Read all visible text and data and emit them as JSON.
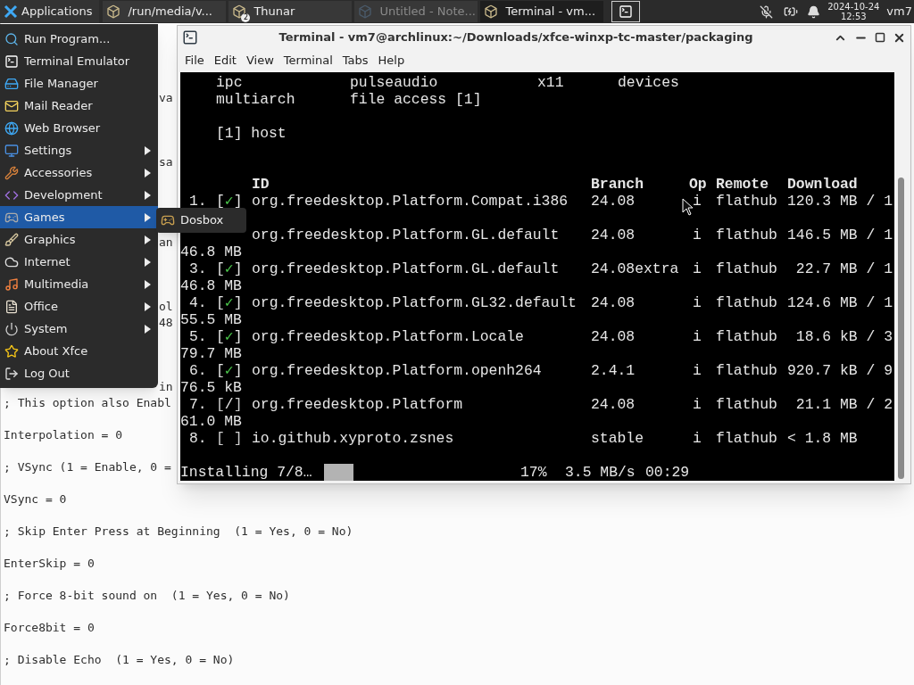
{
  "taskbar": {
    "applications": "Applications",
    "tasks": [
      {
        "title": "/run/media/v...",
        "selected": false,
        "minimized": false
      },
      {
        "title": "Thunar",
        "selected": false,
        "minimized": false,
        "badge": "2"
      },
      {
        "title": "Untitled - Note...",
        "selected": false,
        "minimized": true
      },
      {
        "title": "Terminal - vm...",
        "selected": true,
        "minimized": false
      }
    ],
    "date": "2024-10-24",
    "time": "12:53",
    "user": "vm7"
  },
  "editor": {
    "covered_lines": [
      "va",
      "sa",
      "an",
      "ol",
      "48",
      "in"
    ],
    "lines": [
      "; This option also Enabl",
      "Interpolation = 0",
      "; VSync (1 = Enable, 0 =",
      "VSync = 0",
      "; Skip Enter Press at Beginning  (1 = Yes, 0 = No)",
      "EnterSkip = 0",
      "; Force 8-bit sound on  (1 = Yes, 0 = No)",
      "Force8bit = 0",
      "; Disable Echo  (1 = Yes, 0 = No)"
    ]
  },
  "app_menu": {
    "items": [
      {
        "label": "Run Program...",
        "has_submenu": false,
        "selected": false
      },
      {
        "label": "Terminal Emulator",
        "has_submenu": false,
        "selected": false
      },
      {
        "label": "File Manager",
        "has_submenu": false,
        "selected": false
      },
      {
        "label": "Mail Reader",
        "has_submenu": false,
        "selected": false
      },
      {
        "label": "Web Browser",
        "has_submenu": false,
        "selected": false
      },
      {
        "label": "Settings",
        "has_submenu": true,
        "selected": false
      },
      {
        "label": "Accessories",
        "has_submenu": true,
        "selected": false
      },
      {
        "label": "Development",
        "has_submenu": true,
        "selected": false
      },
      {
        "label": "Games",
        "has_submenu": true,
        "selected": true
      },
      {
        "label": "Graphics",
        "has_submenu": true,
        "selected": false
      },
      {
        "label": "Internet",
        "has_submenu": true,
        "selected": false
      },
      {
        "label": "Multimedia",
        "has_submenu": true,
        "selected": false
      },
      {
        "label": "Office",
        "has_submenu": true,
        "selected": false
      },
      {
        "label": "System",
        "has_submenu": true,
        "selected": false
      },
      {
        "label": "About Xfce",
        "has_submenu": false,
        "selected": false
      },
      {
        "label": "Log Out",
        "has_submenu": false,
        "selected": false
      }
    ],
    "submenu": [
      {
        "label": "Dosbox"
      }
    ]
  },
  "terminal": {
    "title": "Terminal - vm7@archlinux:~/Downloads/xfce-winxp-tc-master/packaging",
    "menu": [
      "File",
      "Edit",
      "View",
      "Terminal",
      "Tabs",
      "Help"
    ],
    "permissions": [
      [
        "ipc",
        "pulseaudio",
        "x11",
        "devices"
      ],
      [
        "multiarch",
        "file access [1]"
      ]
    ],
    "footnote": "[1] host",
    "columns": [
      "ID",
      "Branch",
      "Op",
      "Remote",
      "Download"
    ],
    "rows": [
      {
        "number": "1.",
        "mark": "[✓]",
        "checked": true,
        "id": "org.freedesktop.Platform.Compat.i386",
        "branch": "24.08",
        "op": "i",
        "remote": "flathub",
        "download": "120.3 MB / 1"
      },
      {
        "id": "org.freedesktop.Platform.GL.default",
        "branch": "24.08",
        "op": "i",
        "remote": "flathub",
        "download": "146.5 MB / 1",
        "download_rest": "46.8 MB"
      },
      {
        "number": "3.",
        "mark": "[✓]",
        "checked": true,
        "id": "org.freedesktop.Platform.GL.default",
        "branch": "24.08extra",
        "op": "i",
        "remote": "flathub",
        "download": " 22.7 MB / 1",
        "download_rest": "46.8 MB"
      },
      {
        "number": "4.",
        "mark": "[✓]",
        "checked": true,
        "id": "org.freedesktop.Platform.GL32.default",
        "branch": "24.08",
        "op": "i",
        "remote": "flathub",
        "download": "124.6 MB / 1",
        "download_rest": "55.5 MB"
      },
      {
        "number": "5.",
        "mark": "[✓]",
        "checked": true,
        "id": "org.freedesktop.Platform.Locale",
        "branch": "24.08",
        "op": "i",
        "remote": "flathub",
        "download": " 18.6 kB / 3",
        "download_rest": "79.7 MB"
      },
      {
        "number": "6.",
        "mark": "[✓]",
        "checked": true,
        "id": "org.freedesktop.Platform.openh264",
        "branch": "2.4.1",
        "op": "i",
        "remote": "flathub",
        "download": "920.7 kB / 9",
        "download_rest": "76.5 kB"
      },
      {
        "number": "7.",
        "mark": "[/]",
        "checked": false,
        "id": "org.freedesktop.Platform",
        "branch": "24.08",
        "op": "i",
        "remote": "flathub",
        "download": " 21.1 MB / 2",
        "download_rest": "61.0 MB"
      },
      {
        "number": "8.",
        "mark": "[ ]",
        "checked": false,
        "id": "io.github.xyproto.zsnes",
        "branch": "stable",
        "op": "i",
        "remote": "flathub",
        "download": "< 1.8 MB"
      }
    ],
    "progress": {
      "label": "Installing 7/8…",
      "level": 0.17,
      "percent": "17%",
      "speed": "3.5 MB/s",
      "remaining": "00:29"
    }
  }
}
